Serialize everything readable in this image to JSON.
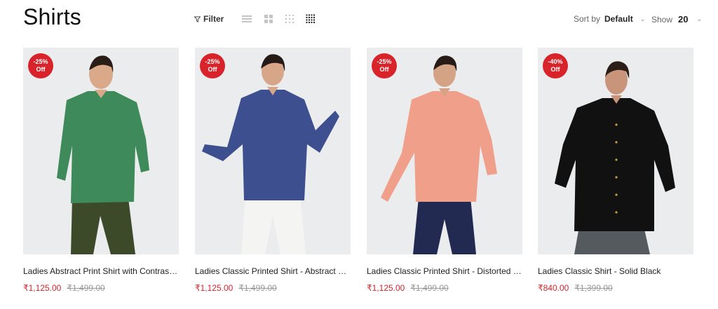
{
  "page_title": "Shirts",
  "toolbar": {
    "filter_label": "Filter",
    "sort_prefix": "Sort by",
    "sort_value": "Default",
    "show_prefix": "Show",
    "show_value": "20",
    "views": [
      "list-view-icon",
      "grid-2-icon",
      "grid-3-icon",
      "grid-4-icon"
    ],
    "active_view": "grid-4-icon"
  },
  "products": [
    {
      "name": "Ladies Abstract Print Shirt with Contrast Sti...",
      "price": "₹1,125.00",
      "original_price": "₹1,499.00",
      "badge_pct": "-25%",
      "badge_off": "Off",
      "shirt_color": "#3e8a5a",
      "pants_color": "#3c4a2a"
    },
    {
      "name": "Ladies Classic Printed Shirt - Abstract Stripes",
      "price": "₹1,125.00",
      "original_price": "₹1,499.00",
      "badge_pct": "-25%",
      "badge_off": "Off",
      "shirt_color": "#3d4f8f",
      "pants_color": "#f4f4f2"
    },
    {
      "name": "Ladies Classic Printed Shirt - Distorted Squ...",
      "price": "₹1,125.00",
      "original_price": "₹1,499.00",
      "badge_pct": "-25%",
      "badge_off": "Off",
      "shirt_color": "#f0a08a",
      "pants_color": "#232a52"
    },
    {
      "name": "Ladies Classic Shirt - Solid Black",
      "price": "₹840.00",
      "original_price": "₹1,399.00",
      "badge_pct": "-40%",
      "badge_off": "Off",
      "shirt_color": "#111111",
      "pants_color": "#555a5e"
    }
  ],
  "colors": {
    "accent": "#d8232a",
    "muted": "#999999"
  }
}
